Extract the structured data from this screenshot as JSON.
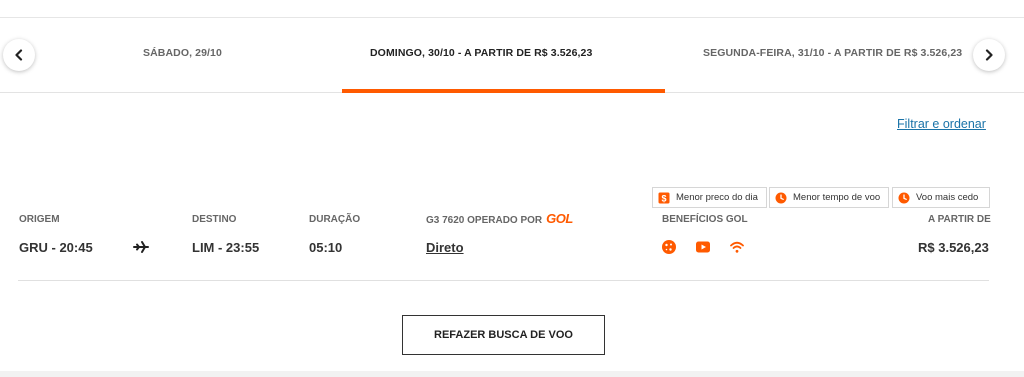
{
  "date_strip": {
    "tabs": [
      {
        "label": "SÁBADO, 29/10"
      },
      {
        "label": "DOMINGO, 30/10 - A PARTIR DE R$ 3.526,23"
      },
      {
        "label": "SEGUNDA-FEIRA, 31/10 - A PARTIR DE R$ 3.526,23"
      }
    ],
    "active_index": 1,
    "prev_icon": "chevron-left-icon",
    "next_icon": "chevron-right-icon",
    "accent_color": "#ff5a00"
  },
  "filter": {
    "label": "Filtrar e ordenar"
  },
  "tags": [
    {
      "label": "Menor preco do dia",
      "icon": "dollar-icon"
    },
    {
      "label": "Menor tempo de voo",
      "icon": "clock-icon"
    },
    {
      "label": "Voo mais cedo",
      "icon": "clock-icon"
    }
  ],
  "flight": {
    "origin_label": "ORIGEM",
    "origin_value": "GRU - 20:45",
    "destination_label": "DESTINO",
    "destination_value": "LIM - 23:55",
    "duration_label": "DURAÇÃO",
    "duration_value": "05:10",
    "operator_label": "G3 7620 OPERADO POR",
    "operator_logo": "GOL",
    "stops_value": "Direto",
    "benefits_label": "BENEFÍCIOS GOL",
    "benefit_icons": [
      "snack-icon",
      "entertainment-icon",
      "wifi-icon"
    ],
    "price_label": "A PARTIR DE",
    "price_value": "R$ 3.526,23"
  },
  "actions": {
    "redo_search_label": "REFAZER BUSCA DE VOO"
  }
}
